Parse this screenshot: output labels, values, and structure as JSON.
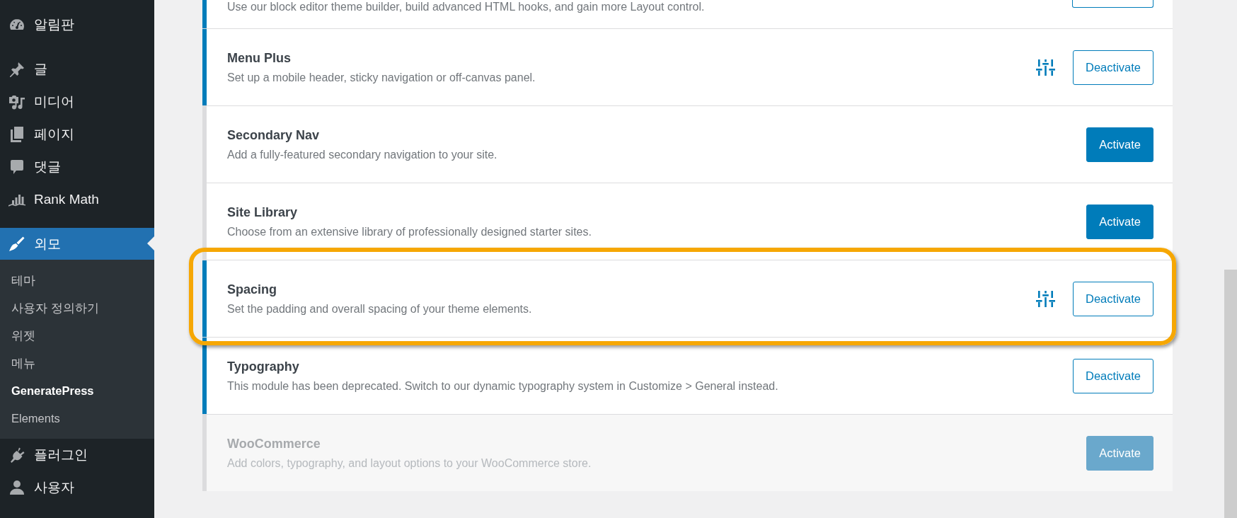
{
  "sidebar": {
    "groups": [
      {
        "items": [
          {
            "label": "알림판",
            "selected": false
          }
        ]
      },
      {
        "items": [
          {
            "label": "글",
            "selected": false
          },
          {
            "label": "미디어",
            "selected": false
          },
          {
            "label": "페이지",
            "selected": false
          },
          {
            "label": "댓글",
            "selected": false
          },
          {
            "label": "Rank Math",
            "selected": false
          }
        ]
      },
      {
        "items": [
          {
            "label": "외모",
            "selected": true,
            "children": [
              {
                "label": "테마",
                "selected": false
              },
              {
                "label": "사용자 정의하기",
                "selected": false
              },
              {
                "label": "위젯",
                "selected": false
              },
              {
                "label": "메뉴",
                "selected": false
              },
              {
                "label": "GeneratePress",
                "selected": true
              },
              {
                "label": "Elements",
                "selected": false
              }
            ]
          },
          {
            "label": "플러그인",
            "selected": false
          },
          {
            "label": "사용자",
            "selected": false
          }
        ]
      }
    ]
  },
  "modules": [
    {
      "kind": "clipped",
      "description": "Use our block editor theme builder, build advanced HTML hooks, and gain more Layout control.",
      "active": true
    },
    {
      "kind": "module",
      "title": "Menu Plus",
      "description": "Set up a mobile header, sticky navigation or off-canvas panel.",
      "active": true,
      "settings": true,
      "button": "Deactivate",
      "disabled": false,
      "highlighted": false
    },
    {
      "kind": "module",
      "title": "Secondary Nav",
      "description": "Add a fully-featured secondary navigation to your site.",
      "active": false,
      "settings": false,
      "button": "Activate",
      "disabled": false,
      "highlighted": false
    },
    {
      "kind": "module",
      "title": "Site Library",
      "description": "Choose from an extensive library of professionally designed starter sites.",
      "active": false,
      "settings": false,
      "button": "Activate",
      "disabled": false,
      "highlighted": false
    },
    {
      "kind": "module",
      "title": "Spacing",
      "description": "Set the padding and overall spacing of your theme elements.",
      "active": true,
      "settings": true,
      "button": "Deactivate",
      "disabled": false,
      "highlighted": true
    },
    {
      "kind": "module",
      "title": "Typography",
      "description": "This module has been deprecated. Switch to our dynamic typography system in Customize > General instead.",
      "active": true,
      "settings": false,
      "button": "Deactivate",
      "disabled": false,
      "highlighted": false
    },
    {
      "kind": "module",
      "title": "WooCommerce",
      "description": "Add colors, typography, and layout options to your WooCommerce store.",
      "active": false,
      "settings": false,
      "button": "Activate",
      "disabled": true,
      "highlighted": false
    }
  ]
}
